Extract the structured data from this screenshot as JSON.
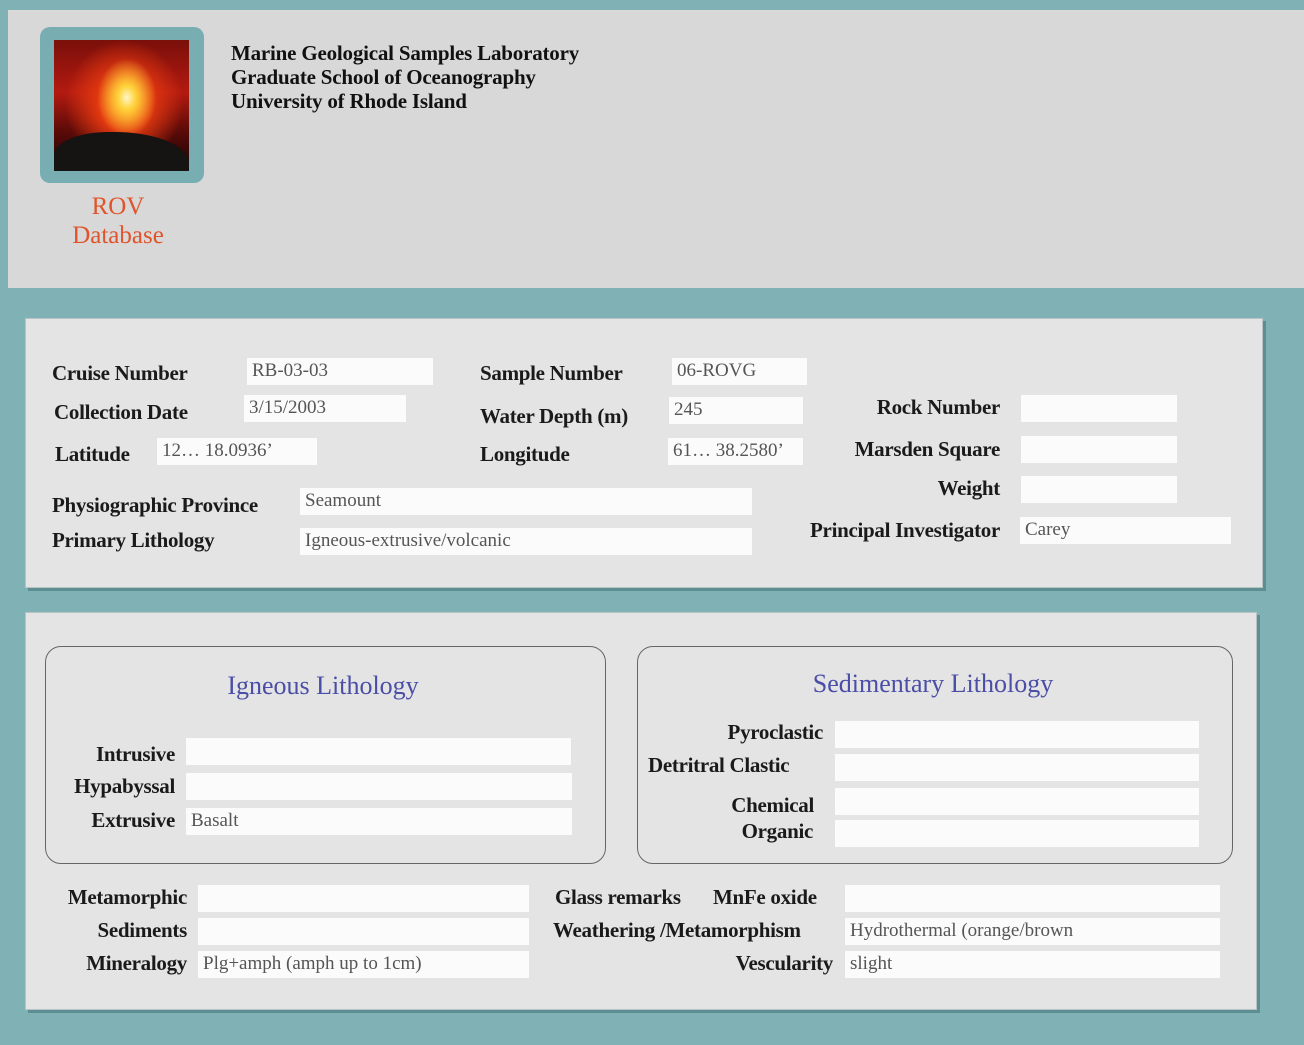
{
  "header": {
    "lab": "Marine Geological Samples Laboratory",
    "school": "Graduate School of Oceanography",
    "university": "University of Rhode Island",
    "app_line1": "ROV",
    "app_line2": "Database"
  },
  "sample": {
    "cruise_number": {
      "label": "Cruise Number",
      "value": "RB-03-03"
    },
    "sample_number": {
      "label": "Sample Number",
      "value": "06-ROVG"
    },
    "collection_date": {
      "label": "Collection Date",
      "value": "3/15/2003"
    },
    "water_depth": {
      "label": "Water Depth (m)",
      "value": "245"
    },
    "latitude": {
      "label": "Latitude",
      "value": "12… 18.0936’"
    },
    "longitude": {
      "label": "Longitude",
      "value": "61… 38.2580’"
    },
    "rock_number": {
      "label": "Rock Number",
      "value": ""
    },
    "marsden_square": {
      "label": "Marsden Square",
      "value": ""
    },
    "weight": {
      "label": "Weight",
      "value": ""
    },
    "principal_investigator": {
      "label": "Principal Investigator",
      "value": "Carey"
    },
    "physiographic_province": {
      "label": "Physiographic Province",
      "value": "Seamount"
    },
    "primary_lithology": {
      "label": "Primary Lithology",
      "value": "Igneous-extrusive/volcanic"
    }
  },
  "igneous": {
    "title": "Igneous Lithology",
    "intrusive": {
      "label": "Intrusive",
      "value": ""
    },
    "hypabyssal": {
      "label": "Hypabyssal",
      "value": ""
    },
    "extrusive": {
      "label": "Extrusive",
      "value": "Basalt"
    }
  },
  "sedimentary": {
    "title": "Sedimentary Lithology",
    "pyroclastic": {
      "label": "Pyroclastic",
      "value": ""
    },
    "detritral_clastic": {
      "label": "Detritral Clastic",
      "value": ""
    },
    "chemical": {
      "label": "Chemical",
      "value": ""
    },
    "organic": {
      "label": "Organic",
      "value": ""
    }
  },
  "other": {
    "metamorphic": {
      "label": "Metamorphic",
      "value": ""
    },
    "sediments": {
      "label": "Sediments",
      "value": ""
    },
    "mineralogy": {
      "label": "Mineralogy",
      "value": "Plg+amph (amph up to 1cm)"
    },
    "glass_remarks": {
      "label": "Glass remarks"
    },
    "mnfe_oxide": {
      "label": "MnFe oxide",
      "value": ""
    },
    "weathering": {
      "label": "Weathering /Metamorphism",
      "value": "Hydrothermal (orange/brown"
    },
    "vescularity": {
      "label": "Vescularity",
      "value": "slight"
    }
  }
}
